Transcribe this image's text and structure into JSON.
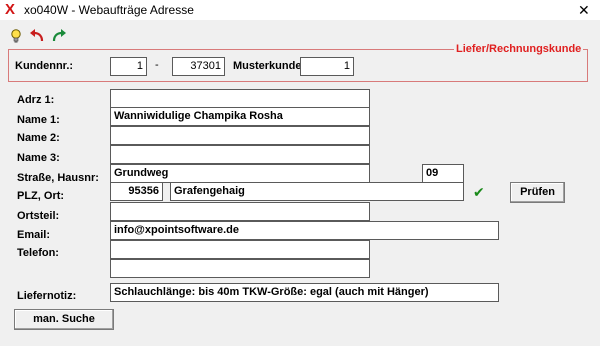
{
  "window": {
    "title": "xo040W - Webaufträge Adresse"
  },
  "group": {
    "legend": "Liefer/Rechnungskunde"
  },
  "kunde": {
    "kundennr_label": "Kundennr.:",
    "kundennr_part1": "1",
    "separator": "-",
    "kundennr_part2": "37301",
    "musterkunde_label": "Musterkunde:",
    "musterkunde_value": "1"
  },
  "form": {
    "adrz1_label": "Adrz 1:",
    "adrz1_value": "",
    "name1_label": "Name 1:",
    "name1_value": "Wanniwidulige Champika Rosha",
    "name2_label": "Name 2:",
    "name2_value": "",
    "name3_label": "Name 3:",
    "name3_value": "",
    "strasse_label": "Straße, Hausnr:",
    "strasse_value": "Grundweg",
    "hausnr_value": "09",
    "plz_label": "PLZ, Ort:",
    "plz_value": "95356",
    "ort_value": "Grafengehaig",
    "ortsteil_label": "Ortsteil:",
    "ortsteil_value": "",
    "email_label": "Email:",
    "email_value": "info@xpointsoftware.de",
    "telefon_label": "Telefon:",
    "telefon_value": "",
    "telefon2_value": "",
    "liefernotiz_label": "Liefernotiz:",
    "liefernotiz_value": "Schlauchlänge: bis 40m TKW-Größe: egal (auch mit Hänger)"
  },
  "buttons": {
    "pruefen": "Prüfen",
    "man_suche": "man. Suche"
  },
  "icons": {
    "app": "x-app-icon",
    "close": "close-icon",
    "bulb": "lightbulb-icon",
    "undo": "undo-arrow-icon",
    "redo": "redo-arrow-icon",
    "check": "check-icon"
  },
  "colors": {
    "accent_red": "#e02020",
    "check_green": "#1a8a1a"
  }
}
